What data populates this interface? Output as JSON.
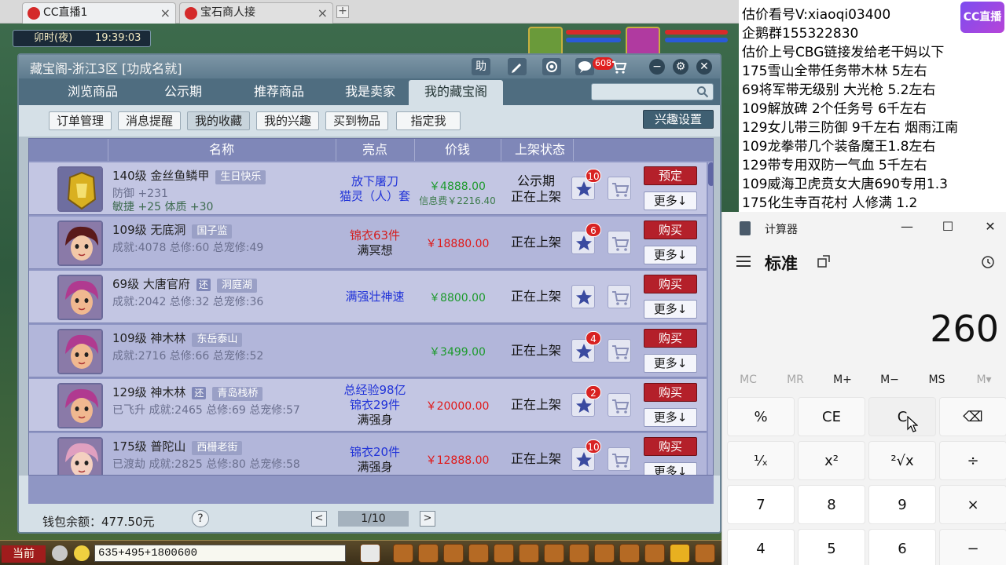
{
  "browser": {
    "tabs": [
      {
        "label": "CC直播1",
        "active": true
      },
      {
        "label": "宝石商人接",
        "active": false
      }
    ],
    "new_tab": "+",
    "close_glyph": "×"
  },
  "game": {
    "clock_period": "卯时(夜)",
    "clock_time": "19:39:03"
  },
  "window": {
    "title": "藏宝阁-浙江3区 [功成名就]",
    "title_icons": [
      "助",
      "pen-icon",
      "record-icon",
      "chat-icon",
      "cart-icon"
    ],
    "help_label": "助",
    "message_count": "608",
    "nav_tabs": [
      "浏览商品",
      "公示期",
      "推荐商品",
      "我是卖家",
      "我的藏宝阁"
    ],
    "active_nav": "我的藏宝阁",
    "search_placeholder": "",
    "sub_tabs": [
      "订单管理",
      "消息提醒",
      "我的收藏",
      "我的兴趣",
      "买到物品",
      "指定我"
    ],
    "active_sub": "我的收藏",
    "interest_settings": "兴趣设置",
    "columns": {
      "name": "名称",
      "highlight": "亮点",
      "price": "价钱",
      "status": "上架状态"
    },
    "rows": [
      {
        "line1": "140级  金丝鱼鳞甲",
        "tag": "生日快乐",
        "huan": "",
        "line2": "防御 +231",
        "line3": "敏捷 +25  体质 +30",
        "hl": [
          "放下屠刀",
          "猫灵（人）套"
        ],
        "hl_colors": [
          "blue",
          "blue"
        ],
        "price": "￥4888.00",
        "price_color": "green",
        "fee": "信息费￥2216.40",
        "status": [
          "公示期",
          "正在上架"
        ],
        "fav": "10",
        "action": "预定",
        "more": "更多↓",
        "avatar": "armor"
      },
      {
        "line1": "109级  无底洞",
        "tag": "国子监",
        "huan": "",
        "line2": "成就:4078  总修:60  总宠修:49",
        "line3": "",
        "hl": [
          "锦衣63件",
          "满冥想"
        ],
        "hl_colors": [
          "red",
          "dark"
        ],
        "price": "￥18880.00",
        "price_color": "red",
        "fee": "",
        "status": [
          "正在上架"
        ],
        "fav": "6",
        "action": "购买",
        "more": "更多↓",
        "avatar": "girl"
      },
      {
        "line1": "69级  大唐官府",
        "tag": "洞庭湖",
        "huan": "还",
        "line2": "成就:2042  总修:32  总宠修:36",
        "line3": "",
        "hl": [
          "满强壮神速"
        ],
        "hl_colors": [
          "blue"
        ],
        "price": "￥8800.00",
        "price_color": "green",
        "fee": "",
        "status": [
          "正在上架"
        ],
        "fav": "",
        "action": "购买",
        "more": "更多↓",
        "avatar": "boy"
      },
      {
        "line1": "109级  神木林",
        "tag": "东岳泰山",
        "huan": "",
        "line2": "成就:2716  总修:66  总宠修:52",
        "line3": "",
        "hl": [],
        "hl_colors": [],
        "price": "￥3499.00",
        "price_color": "green",
        "fee": "",
        "status": [
          "正在上架"
        ],
        "fav": "4",
        "action": "购买",
        "more": "更多↓",
        "avatar": "boy"
      },
      {
        "line1": "129级  神木林",
        "tag": "青岛栈桥",
        "huan": "还",
        "line2": "已飞升  成就:2465  总修:69  总宠修:57",
        "line3": "",
        "hl": [
          "总经验98亿",
          "锦衣29件",
          "满强身"
        ],
        "hl_colors": [
          "blue",
          "blue",
          "dark"
        ],
        "price": "￥20000.00",
        "price_color": "red",
        "fee": "",
        "status": [
          "正在上架"
        ],
        "fav": "2",
        "action": "购买",
        "more": "更多↓",
        "avatar": "boy"
      },
      {
        "line1": "175级  普陀山",
        "tag": "西栅老街",
        "huan": "",
        "line2": "已渡劫  成就:2825  总修:80  总宠修:58",
        "line3": "",
        "hl": [
          "锦衣20件",
          "满强身"
        ],
        "hl_colors": [
          "blue",
          "dark"
        ],
        "price": "￥12888.00",
        "price_color": "red",
        "fee": "",
        "status": [
          "正在上架"
        ],
        "fav": "10",
        "action": "购买",
        "more": "更多↓",
        "avatar": "fairy"
      }
    ],
    "wallet": "钱包余额：477.50元",
    "help_glyph": "?",
    "page": "1/10",
    "prev": "<",
    "next": ">"
  },
  "chat": {
    "channel": "当前",
    "input_value": "635+495+1800600"
  },
  "overlay": {
    "lines": [
      "估价看号V:xiaoqi03400",
      "企鹅群155322830",
      "估价上号CBG链接发给老干妈以下",
      "175雪山全带任务带木林 5左右",
      "69将军带无级别 大光枪 5.2左右",
      "109解放碑 2个任务号 6千左右",
      "129女儿带三防御 9千左右 烟雨江南",
      "109龙拳带几个装备魔王1.8左右",
      "129带专用双防一气血 5千左右",
      "109威海卫虎贲女大唐690专用1.3",
      "175化生寺百花村 人修满 1.2"
    ],
    "logo": "CC直播"
  },
  "calculator": {
    "title": "计算器",
    "mode": "标准",
    "display": "260",
    "window_controls": [
      "—",
      "☐",
      "✕"
    ],
    "memory": [
      "MC",
      "MR",
      "M+",
      "M−",
      "MS",
      "M▾"
    ],
    "memory_enabled": [
      false,
      false,
      true,
      true,
      true,
      false
    ],
    "keys_row1": [
      "%",
      "CE",
      "C",
      "⌫"
    ],
    "keys_row2": [
      "¹⁄ₓ",
      "x²",
      "²√x",
      "÷"
    ],
    "keys_row3": [
      "7",
      "8",
      "9",
      "×"
    ],
    "keys_row4": [
      "4",
      "5",
      "6",
      "−"
    ]
  },
  "colors": {
    "buy_button": "#b4202a",
    "list_bg": "#8f96c4",
    "nav_bg": "#4f6d80",
    "price_green": "#1c9a2c",
    "price_red": "#e01818"
  }
}
